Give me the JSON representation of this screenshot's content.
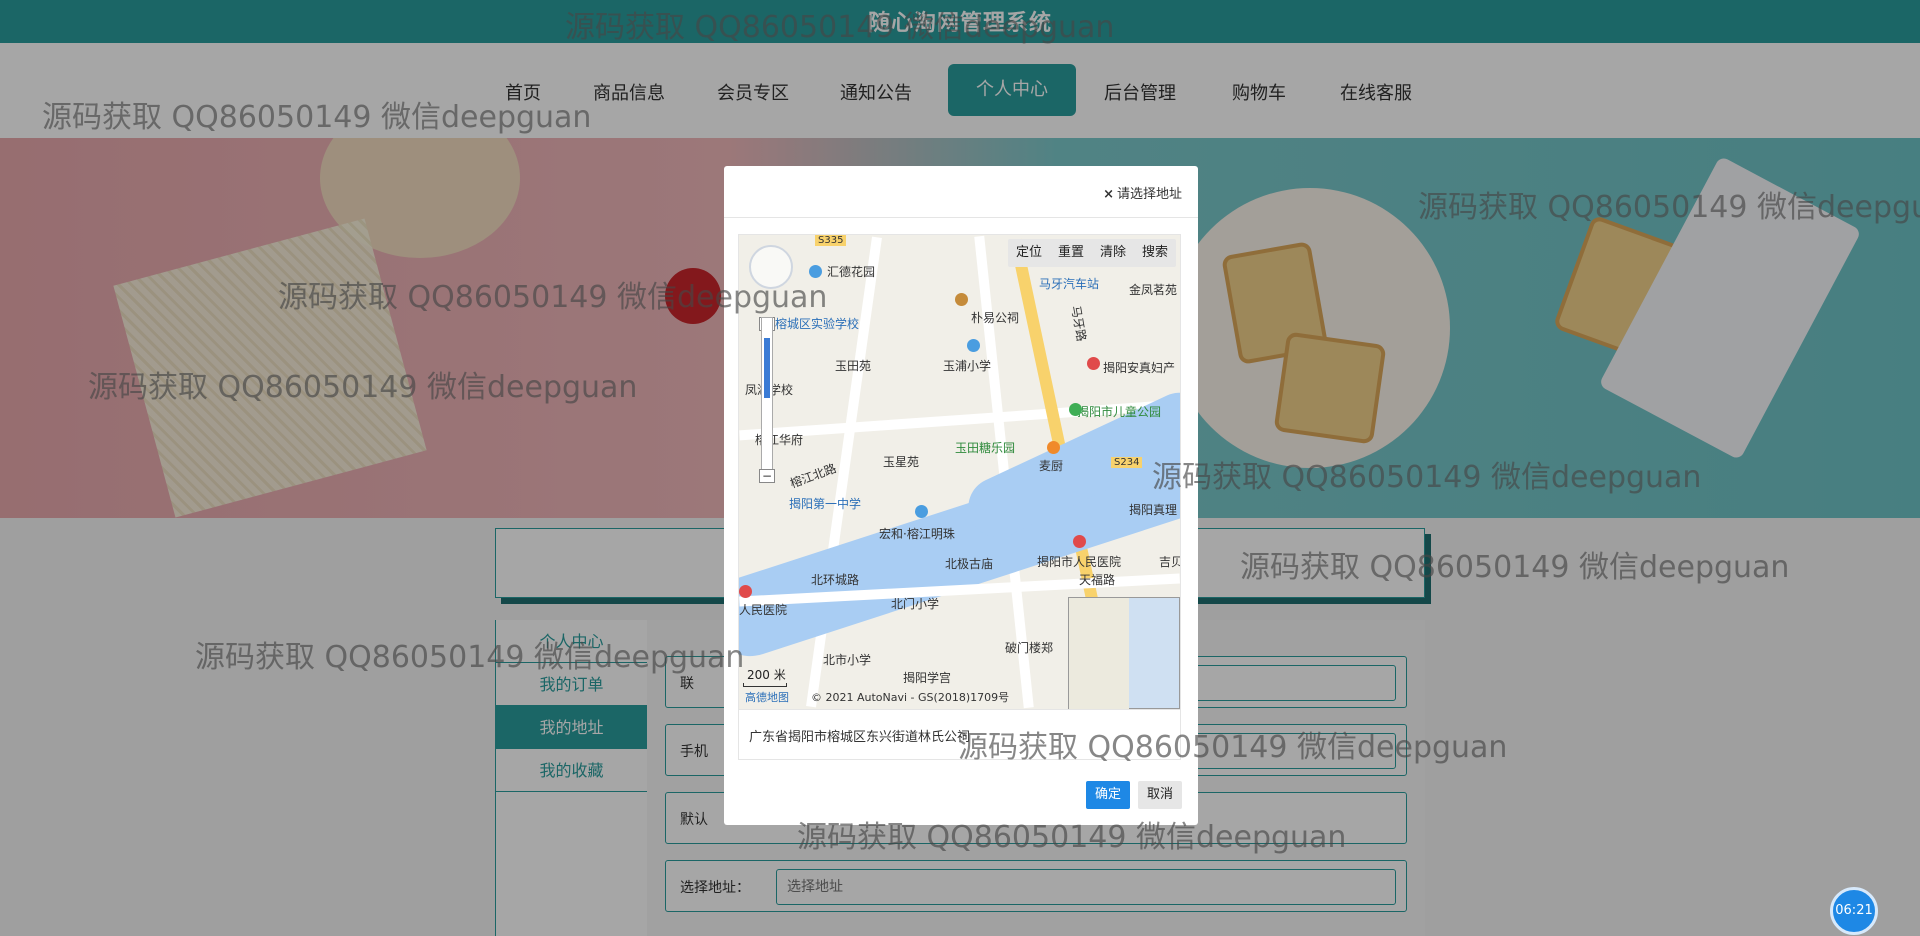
{
  "app": {
    "title": "随心淘网管理系统"
  },
  "nav": {
    "items": [
      {
        "label": "首页"
      },
      {
        "label": "商品信息"
      },
      {
        "label": "会员专区"
      },
      {
        "label": "通知公告"
      },
      {
        "label": "个人中心"
      },
      {
        "label": "后台管理"
      },
      {
        "label": "购物车"
      },
      {
        "label": "在线客服"
      }
    ],
    "active": "个人中心"
  },
  "sidebar": {
    "items": [
      {
        "label": "个人中心"
      },
      {
        "label": "我的订单"
      },
      {
        "label": "我的地址"
      },
      {
        "label": "我的收藏"
      }
    ],
    "active": "我的地址"
  },
  "form": {
    "row1_label": "联",
    "row2_label": "手机",
    "row3_label": "默认",
    "address_label": "选择地址：",
    "address_placeholder": "选择地址"
  },
  "modal": {
    "title": "请选择地址",
    "close_icon": "×",
    "map_tools": [
      "定位",
      "重置",
      "清除",
      "搜索"
    ],
    "zoom_in": "+",
    "zoom_out": "−",
    "scale": "200 米",
    "copyright": "© 2021 AutoNavi - GS(2018)1709号",
    "map_logo": "高德地图",
    "pois": {
      "p1": "汇德花园",
      "p2": "榕城区实验学校",
      "p3": "朴易公祠",
      "p4": "马牙汽车站",
      "p5": "金凤茗苑",
      "p6": "玉田苑",
      "p7": "玉浦小学",
      "p8": "揭阳安真妇产",
      "p9": "凤湖学校",
      "p10": "揭阳市儿童公园",
      "p11": "榕江华府",
      "p12": "玉田糖乐园",
      "p13": "玉星苑",
      "p14": "麦厨",
      "p15": "揭阳第一中学",
      "p16": "宏和·榕江明珠",
      "p17": "揭阳真理",
      "p18": "揭阳市人民医院",
      "p19": "北极古庙",
      "p20": "天福路",
      "p21": "北环城路",
      "p22": "人民医院",
      "p23": "北门小学",
      "p24": "北市小学",
      "p25": "破门楼郑",
      "p26": "揭阳学宫",
      "p27": "S335",
      "p28": "S234",
      "p29": "榕江北路",
      "p30": "马牙路",
      "p31": "吉贝"
    },
    "selected_address": "广东省揭阳市榕城区东兴街道林氏公祠",
    "confirm_label": "确定",
    "cancel_label": "取消"
  },
  "watermark": "源码获取 QQ86050149 微信deepguan",
  "clock": "06:21"
}
